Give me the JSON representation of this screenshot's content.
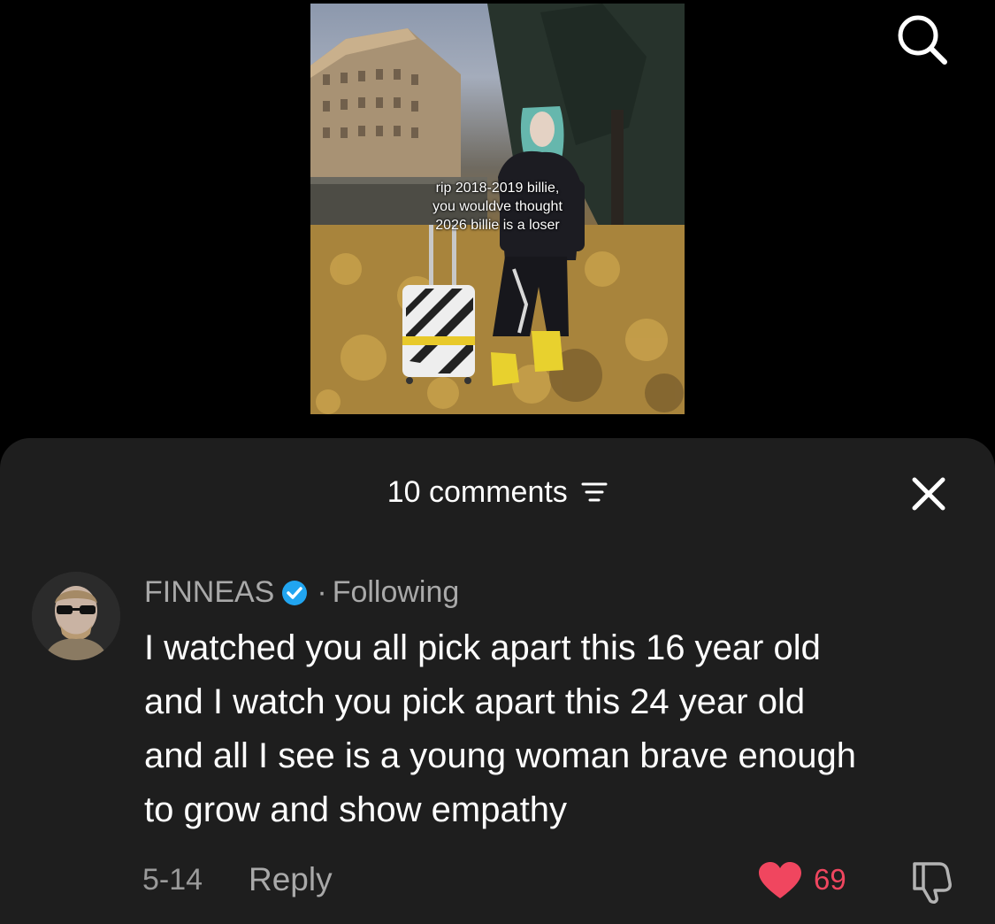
{
  "video": {
    "caption_lines": [
      "rip 2018-2019 billie,",
      "you wouldve thought",
      "2026 billie is a loser"
    ]
  },
  "top_bar": {
    "search_icon": "search-icon"
  },
  "comments_panel": {
    "title": "10 comments",
    "filter_icon": "filter-icon",
    "close_icon": "close-icon"
  },
  "comment": {
    "username": "FINNEAS",
    "verified_icon": "verified-badge-icon",
    "separator": "·",
    "follow_status": "Following",
    "text_lines": [
      "I watched you all pick apart this 16 year old",
      "and I watch you pick apart this 24 year old",
      "and all I see is a young woman brave enough",
      "to grow and show empathy"
    ],
    "date": "5-14",
    "reply_label": "Reply",
    "like_icon": "heart-icon",
    "like_count": "69",
    "dislike_icon": "dislike-icon",
    "like_color": "#f0465f",
    "verified_color": "#21a5f0"
  }
}
